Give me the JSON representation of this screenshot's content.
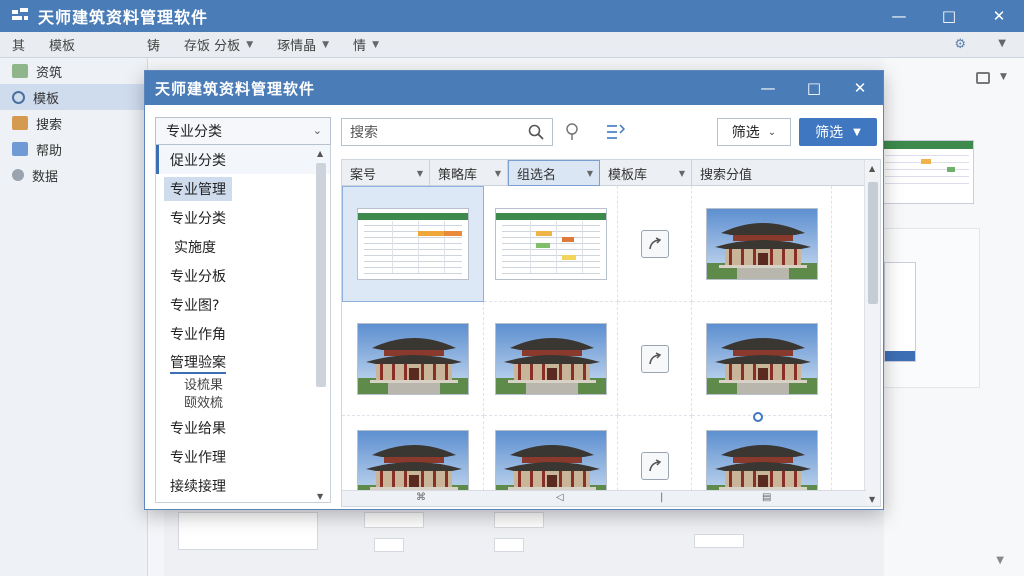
{
  "app": {
    "title": "天师建筑资料管理软件"
  },
  "background": {
    "menubar": [
      {
        "label": "其",
        "has_dropdown": false
      },
      {
        "label": "模板",
        "has_dropdown": false
      },
      {
        "label": "铸",
        "has_dropdown": false
      },
      {
        "label": "存饭 分板",
        "has_dropdown": true
      },
      {
        "label": "琢情晶",
        "has_dropdown": true
      },
      {
        "label": "情",
        "has_dropdown": true
      }
    ],
    "sidebar": [
      {
        "label": "资筑",
        "icon": "document-icon"
      },
      {
        "label": "模板",
        "icon": "search-icon",
        "active": true
      },
      {
        "label": "搜索",
        "icon": "stack-icon"
      },
      {
        "label": "帮助",
        "icon": "link-icon"
      },
      {
        "label": "数据",
        "icon": "person-icon"
      }
    ]
  },
  "dialog": {
    "title": "天师建筑资料管理软件",
    "category_select": "专业分类",
    "categories": [
      {
        "label": "促业分类",
        "style": "first"
      },
      {
        "label": "专业管理",
        "style": "selected"
      },
      {
        "label": "专业分类",
        "style": "normal"
      },
      {
        "label": "实施度",
        "style": "indent"
      },
      {
        "label": "专业分板",
        "style": "normal"
      },
      {
        "label": "专业图?",
        "style": "normal"
      },
      {
        "label": "专业作角",
        "style": "normal"
      },
      {
        "label": "管理验案",
        "style": "underline"
      }
    ],
    "category_subitems": [
      "设梳果",
      "颐效梳"
    ],
    "categories_after": [
      {
        "label": "专业给果",
        "style": "normal"
      },
      {
        "label": "专业作理",
        "style": "normal"
      },
      {
        "label": "接续接理",
        "style": "normal"
      }
    ],
    "search": {
      "placeholder": "搜索"
    },
    "filter_label": "筛选",
    "filter_primary_label": "筛选",
    "columns": [
      "案号",
      "策略库",
      "组选名",
      "模板库",
      "搜索分值"
    ],
    "grid": {
      "rows": [
        [
          "spreadsheet",
          "spreadsheet",
          "link",
          "building"
        ],
        [
          "building",
          "building",
          "link",
          "building"
        ],
        [
          "building",
          "building",
          "link",
          "building"
        ]
      ]
    },
    "footer_icons": [
      "⌘",
      "◁",
      "|",
      "▤"
    ]
  },
  "colors": {
    "titlebar": "#4a7cb8",
    "accent": "#3f78c0",
    "selection": "#dde8f6",
    "sheet_header": "#3d8a4c"
  }
}
